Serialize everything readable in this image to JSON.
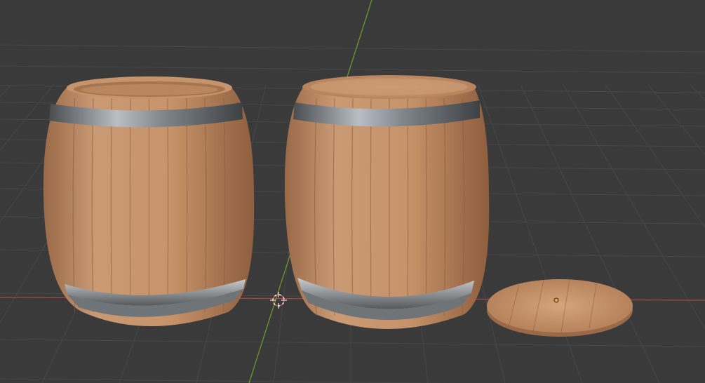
{
  "viewport": {
    "background": "#3a3a3a",
    "grid_color": "#4a4a4a",
    "x_axis_color": "#b5473f",
    "y_axis_color": "#6a9a2a"
  },
  "scene": {
    "objects": [
      {
        "name": "barrel-open",
        "type": "barrel",
        "top": "open"
      },
      {
        "name": "barrel-closed",
        "type": "barrel",
        "top": "closed"
      },
      {
        "name": "barrel-lid",
        "type": "lid"
      }
    ],
    "wood_color": "#c08a62",
    "wood_dark": "#8a5a3a",
    "hoop_color": "#9aa0a5"
  },
  "gizmos": {
    "cursor_3d": "3d-cursor-icon",
    "origin": "origin-point-icon"
  }
}
